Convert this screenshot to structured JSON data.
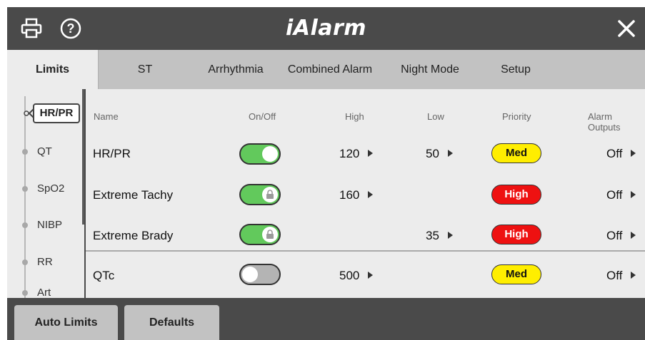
{
  "header": {
    "title": "Alarm",
    "title_prefix": "i"
  },
  "tabs": [
    {
      "label": "Limits",
      "active": true
    },
    {
      "label": "ST"
    },
    {
      "label": "Arrhythmia"
    },
    {
      "label": "Combined Alarm"
    },
    {
      "label": "Night Mode"
    },
    {
      "label": "Setup"
    }
  ],
  "sidenav": {
    "items": [
      {
        "label": "HR/PR",
        "active": true
      },
      {
        "label": "QT"
      },
      {
        "label": "SpO2"
      },
      {
        "label": "NIBP"
      },
      {
        "label": "RR"
      },
      {
        "label": "Art"
      }
    ]
  },
  "table": {
    "columns": {
      "name": "Name",
      "onoff": "On/Off",
      "high": "High",
      "low": "Low",
      "priority": "Priority",
      "outputs": "Alarm Outputs"
    },
    "rows": [
      {
        "name": "HR/PR",
        "on": true,
        "locked": false,
        "high": "120",
        "low": "50",
        "priority": "Med",
        "output": "Off"
      },
      {
        "name": "Extreme Tachy",
        "on": true,
        "locked": true,
        "high": "160",
        "low": "",
        "priority": "High",
        "output": "Off"
      },
      {
        "name": "Extreme Brady",
        "on": true,
        "locked": true,
        "high": "",
        "low": "35",
        "priority": "High",
        "output": "Off"
      },
      {
        "name": "QTc",
        "on": false,
        "locked": false,
        "high": "500",
        "low": "",
        "priority": "Med",
        "output": "Off"
      }
    ]
  },
  "footer": {
    "auto_limits": "Auto Limits",
    "defaults": "Defaults"
  },
  "colors": {
    "priority_med": "#ffee00",
    "priority_high": "#ee1111",
    "toggle_on": "#62c95c",
    "toggle_off": "#b4b4b4"
  }
}
